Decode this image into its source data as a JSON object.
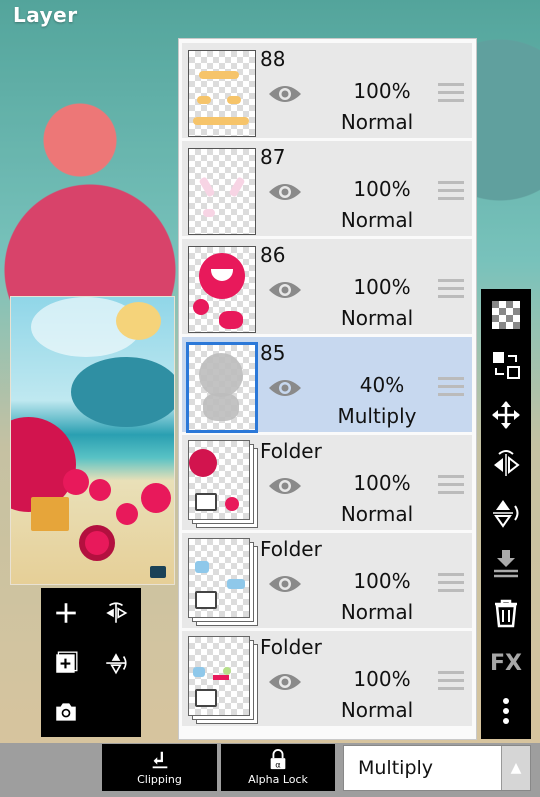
{
  "header": {
    "title": "Layer"
  },
  "layers": [
    {
      "name": "88",
      "opacity": "100%",
      "blend": "Normal",
      "type": "layer",
      "selected": false
    },
    {
      "name": "87",
      "opacity": "100%",
      "blend": "Normal",
      "type": "layer",
      "selected": false
    },
    {
      "name": "86",
      "opacity": "100%",
      "blend": "Normal",
      "type": "layer",
      "selected": false
    },
    {
      "name": "85",
      "opacity": "40%",
      "blend": "Multiply",
      "type": "layer",
      "selected": true
    },
    {
      "name": "Folder",
      "opacity": "100%",
      "blend": "Normal",
      "type": "folder",
      "selected": false
    },
    {
      "name": "Folder",
      "opacity": "100%",
      "blend": "Normal",
      "type": "folder",
      "selected": false
    },
    {
      "name": "Folder",
      "opacity": "100%",
      "blend": "Normal",
      "type": "folder",
      "selected": false
    }
  ],
  "side_toolbar": {
    "fx_label": "FX",
    "icons": [
      "transparency-checker-icon",
      "swap-layer-icon",
      "move-icon",
      "flip-horizontal-icon",
      "flip-vertical-icon",
      "merge-down-icon",
      "trash-icon",
      "fx-icon",
      "more-icon"
    ]
  },
  "left_tools": {
    "icons": [
      "add-layer-icon",
      "flip-horizontal-icon",
      "add-folder-icon",
      "flip-vertical-icon",
      "camera-icon"
    ]
  },
  "bottom_bar": {
    "clipping_label": "Clipping",
    "alpha_lock_label": "Alpha Lock",
    "blend_mode_value": "Multiply"
  },
  "colors": {
    "selected_row": "#c7d8ef",
    "selection_border": "#2b78d8",
    "toolbar_bg": "#000000"
  }
}
